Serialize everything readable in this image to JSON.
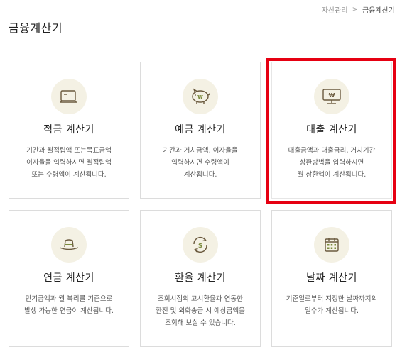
{
  "breadcrumb": {
    "parent": "자산관리",
    "separator": ">",
    "current": "금융계산기"
  },
  "page": {
    "title": "금융계산기"
  },
  "calculators": [
    {
      "title": "적금 계산기",
      "description": "기간과 월적립액 또는목표금액\n이자율을 입력하시면 월적립액\n또는 수령액이 계산됩니다.",
      "icon": "calendar-card-icon"
    },
    {
      "title": "예금 계산기",
      "description": "기간과 거치금액, 이자율을\n입력하시면 수령액이\n계산됩니다.",
      "icon": "piggy-bank-icon"
    },
    {
      "title": "대출 계산기",
      "description": "대출금액과 대출금리, 거치기간\n상환방법을 입력하시면\n월 상환액이 계산됩니다.",
      "icon": "monitor-won-icon"
    },
    {
      "title": "연금 계산기",
      "description": "만기금액과 월 복리를 기준으로\n발생 가능한 연금이 계산됩니다.",
      "icon": "hat-icon"
    },
    {
      "title": "환율 계산기",
      "description": "조회시점의 고시환율과 연동한\n환전 및 외화송금 시 예상금액을\n조회해 보실 수 있습니다.",
      "icon": "currency-exchange-icon"
    },
    {
      "title": "날짜 계산기",
      "description": "기준일로부터 지정한 날짜까지의\n일수가 계산됩니다.",
      "icon": "calendar-icon"
    }
  ],
  "colors": {
    "icon_bg": "#f4f1e4",
    "icon_stroke": "#6b5a3e",
    "icon_accent": "#7a8a3c",
    "highlight": "#e60012",
    "card_border": "#dcdcdc"
  }
}
